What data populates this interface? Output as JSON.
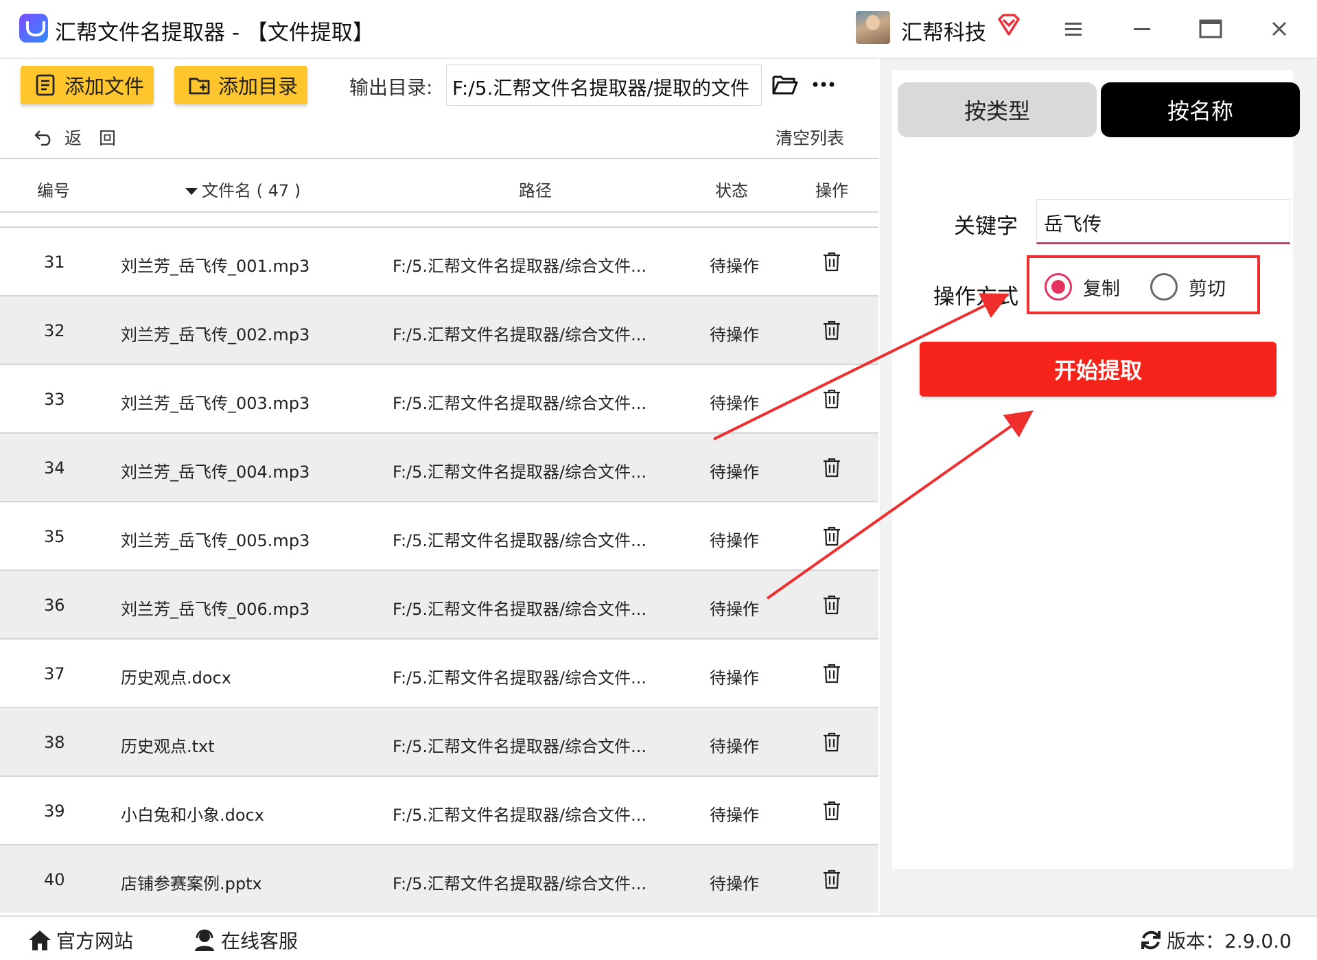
{
  "window": {
    "title": "汇帮文件名提取器 - 【文件提取】",
    "brand": "汇帮科技"
  },
  "toolbar": {
    "add_file": "添加文件",
    "add_dir": "添加目录",
    "output_label": "输出目录:",
    "output_path": "F:/5.汇帮文件名提取器/提取的文件",
    "back": "返　回",
    "clear_list": "清空列表"
  },
  "table": {
    "headers": {
      "no": "编号",
      "name": "文件名 ( 47 )",
      "path": "路径",
      "status": "状态",
      "op": "操作"
    },
    "rows": [
      {
        "no": "31",
        "name": "刘兰芳_岳飞传_001.mp3",
        "path": "F:/5.汇帮文件名提取器/综合文件...",
        "status": "待操作"
      },
      {
        "no": "32",
        "name": "刘兰芳_岳飞传_002.mp3",
        "path": "F:/5.汇帮文件名提取器/综合文件...",
        "status": "待操作"
      },
      {
        "no": "33",
        "name": "刘兰芳_岳飞传_003.mp3",
        "path": "F:/5.汇帮文件名提取器/综合文件...",
        "status": "待操作"
      },
      {
        "no": "34",
        "name": "刘兰芳_岳飞传_004.mp3",
        "path": "F:/5.汇帮文件名提取器/综合文件...",
        "status": "待操作"
      },
      {
        "no": "35",
        "name": "刘兰芳_岳飞传_005.mp3",
        "path": "F:/5.汇帮文件名提取器/综合文件...",
        "status": "待操作"
      },
      {
        "no": "36",
        "name": "刘兰芳_岳飞传_006.mp3",
        "path": "F:/5.汇帮文件名提取器/综合文件...",
        "status": "待操作"
      },
      {
        "no": "37",
        "name": "历史观点.docx",
        "path": "F:/5.汇帮文件名提取器/综合文件...",
        "status": "待操作"
      },
      {
        "no": "38",
        "name": "历史观点.txt",
        "path": "F:/5.汇帮文件名提取器/综合文件...",
        "status": "待操作"
      },
      {
        "no": "39",
        "name": "小白兔和小象.docx",
        "path": "F:/5.汇帮文件名提取器/综合文件...",
        "status": "待操作"
      },
      {
        "no": "40",
        "name": "店铺参赛案例.pptx",
        "path": "F:/5.汇帮文件名提取器/综合文件...",
        "status": "待操作"
      }
    ]
  },
  "right": {
    "tab_type": "按类型",
    "tab_name": "按名称",
    "keyword_label": "关键字",
    "keyword_value": "岳飞传",
    "op_label": "操作方式",
    "opt_copy": "复制",
    "opt_cut": "剪切",
    "selected_option": "复制",
    "start": "开始提取"
  },
  "footer": {
    "site": "官方网站",
    "service": "在线客服",
    "version": "版本：2.9.0.0"
  },
  "colors": {
    "accent_yellow": "#fec62c",
    "start_red": "#f5231a",
    "radio_pink": "#e5335f",
    "annotation_red": "#ef2e2e"
  }
}
